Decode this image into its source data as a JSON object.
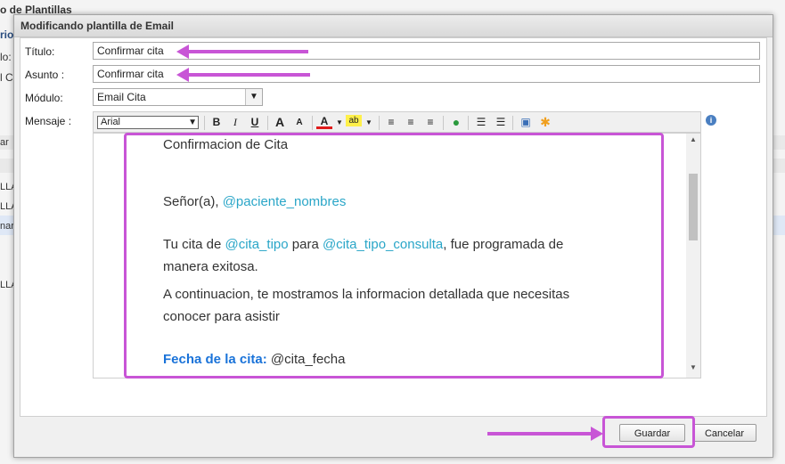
{
  "background": {
    "title": "o de Plantillas",
    "subtitle": "rio",
    "label1": "lo:",
    "label2": "l Ci",
    "col_header": "ar",
    "rows": [
      "LLA",
      "LLA",
      "nar c",
      "LLA"
    ]
  },
  "dialog": {
    "title": "Modificando plantilla de Email",
    "fields": {
      "titulo_label": "Título:",
      "titulo_value": "Confirmar cita",
      "asunto_label": "Asunto :",
      "asunto_value": "Confirmar cita",
      "modulo_label": "Módulo:",
      "modulo_value": "Email Cita",
      "mensaje_label": "Mensaje :"
    },
    "toolbar": {
      "font": "Arial",
      "bold": "B",
      "italic": "I",
      "underline": "U",
      "grow": "A",
      "shrink": "A",
      "font_color": "A",
      "highlight": "ab"
    },
    "message": {
      "heading": "Confirmacion de Cita",
      "greeting_prefix": "Señor(a), ",
      "greeting_var": "@paciente_nombres",
      "p1_a": "Tu cita de ",
      "p1_var1": "@cita_tipo",
      "p1_b": " para ",
      "p1_var2": "@cita_tipo_consulta",
      "p1_c": ", fue programada de",
      "p1_d": "manera exitosa.",
      "p2_a": "A continuacion, te mostramos la informacion detallada que necesitas",
      "p2_b": "conocer para asistir",
      "date_label": "Fecha de la cita:",
      "date_var": " @cita_fecha"
    },
    "buttons": {
      "save": "Guardar",
      "cancel": "Cancelar"
    }
  },
  "colors": {
    "annotation": "#c855d6",
    "variable": "#2aa6c8",
    "emphasis": "#1a73d9"
  }
}
